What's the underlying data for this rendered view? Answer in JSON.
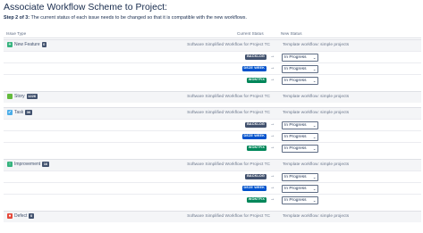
{
  "page": {
    "title": "Associate Workflow Scheme to Project:",
    "step_bold": "Step 2 of 3:",
    "step_text": "The current status of each issue needs to be changed so that it is compatible with the new workflows."
  },
  "table": {
    "headers": {
      "issue_type": "Issue Type",
      "current_status": "Current Status",
      "new_status": "New Status"
    },
    "colors": {
      "backlog": "#42526e",
      "deze_week": "#0052cc",
      "wontfix": "#00875a"
    }
  },
  "groups": [
    {
      "name": "New Feature",
      "count": "0",
      "icon": "new-feature-icon",
      "icon_color": "#36b37e",
      "icon_glyph": "+",
      "current_workflow": "Software Simplified Workflow for Project TC",
      "new_workflow": "Template workflow: simple projects",
      "mappings": [
        {
          "status": "BACKLOG",
          "color_key": "backlog",
          "new": "In Progress"
        },
        {
          "status": "DEZE WEEK",
          "color_key": "deze_week",
          "new": "In Progress"
        },
        {
          "status": "WONTFIX",
          "color_key": "wontfix",
          "new": "In Progress"
        }
      ]
    },
    {
      "name": "Story",
      "count": "1226",
      "icon": "story-icon",
      "icon_color": "#63ba3c",
      "icon_glyph": "",
      "current_workflow": "Software Simplified Workflow for Project TC",
      "new_workflow": "Template workflow: simple projects",
      "mappings": []
    },
    {
      "name": "Task",
      "count": "36",
      "icon": "task-icon",
      "icon_color": "#4bade8",
      "icon_glyph": "✓",
      "current_workflow": "Software Simplified Workflow for Project TC",
      "new_workflow": "Template workflow: simple projects",
      "mappings": [
        {
          "status": "BACKLOG",
          "color_key": "backlog",
          "new": "In Progress"
        },
        {
          "status": "DEZE WEEK",
          "color_key": "deze_week",
          "new": "In Progress"
        },
        {
          "status": "WONTFIX",
          "color_key": "wontfix",
          "new": "In Progress"
        }
      ]
    },
    {
      "name": "Improvement",
      "count": "16",
      "icon": "improvement-icon",
      "icon_color": "#36b37e",
      "icon_glyph": "↑",
      "current_workflow": "Software Simplified Workflow for Project TC",
      "new_workflow": "Template workflow: simple projects",
      "mappings": [
        {
          "status": "BACKLOG",
          "color_key": "backlog",
          "new": "In Progress"
        },
        {
          "status": "DEZE WEEK",
          "color_key": "deze_week",
          "new": "In Progress"
        },
        {
          "status": "WONTFIX",
          "color_key": "wontfix",
          "new": "In Progress"
        }
      ]
    },
    {
      "name": "Defect",
      "count": "0",
      "icon": "defect-icon",
      "icon_color": "#e5493a",
      "icon_glyph": "●",
      "current_workflow": "Software Simplified Workflow for Project TC",
      "new_workflow": "Template workflow: simple projects",
      "mappings": []
    }
  ]
}
